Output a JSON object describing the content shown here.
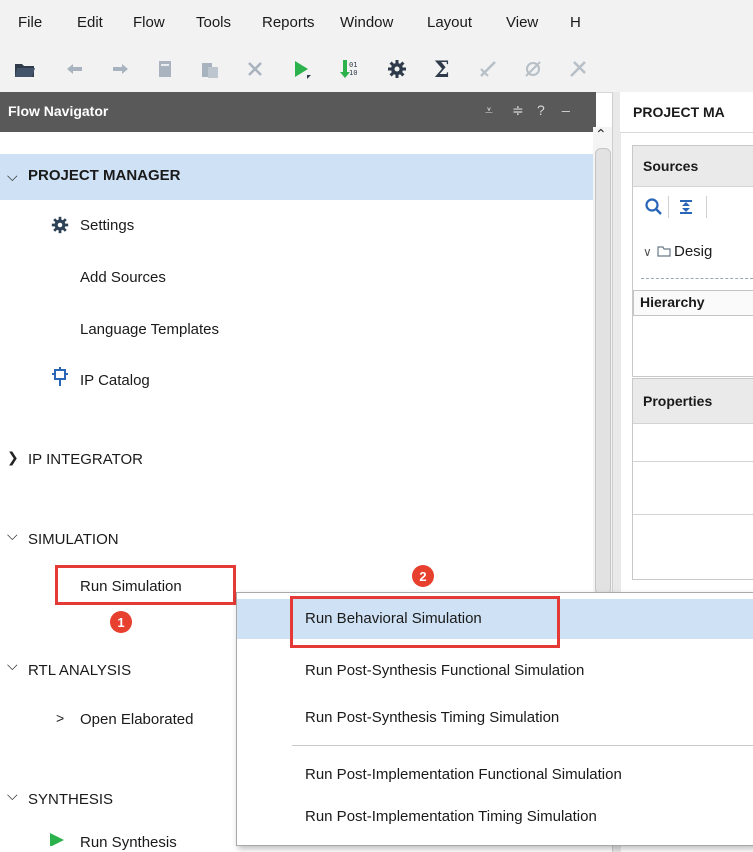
{
  "menubar": {
    "items": [
      {
        "label": "File"
      },
      {
        "label": "Edit"
      },
      {
        "label": "Flow"
      },
      {
        "label": "Tools"
      },
      {
        "label": "Reports"
      },
      {
        "label": "Window"
      },
      {
        "label": "Layout"
      },
      {
        "label": "View"
      },
      {
        "label": "H"
      }
    ]
  },
  "toolbar": {
    "icons": [
      "open-folder-icon",
      "undo-icon",
      "redo-icon",
      "copy-icon",
      "paste-icon",
      "delete-icon",
      "run-icon",
      "program-icon",
      "settings-icon",
      "sum-icon",
      "disabled-tool-icon",
      "disabled-tool-icon-2",
      "disabled-tool-icon-3"
    ]
  },
  "flow_navigator": {
    "title": "Flow Navigator",
    "controls": {
      "collapse": "⩡",
      "expand": "≑",
      "help": "?",
      "minimize": "_"
    },
    "project_manager": {
      "label": "PROJECT MANAGER",
      "items": [
        "Settings",
        "Add Sources",
        "Language Templates",
        "IP Catalog"
      ]
    },
    "ip_integrator": {
      "label": "IP INTEGRATOR"
    },
    "simulation": {
      "label": "SIMULATION",
      "run": "Run Simulation"
    },
    "rtl_analysis": {
      "label": "RTL ANALYSIS",
      "open": "Open Elaborated"
    },
    "synthesis": {
      "label": "SYNTHESIS",
      "run": "Run Synthesis"
    }
  },
  "right_panel": {
    "header": "PROJECT MA",
    "sources": {
      "title": "Sources",
      "tree_item": "Desig",
      "tab": "Hierarchy"
    },
    "properties": {
      "title": "Properties"
    }
  },
  "callouts": {
    "one": "1",
    "two": "2"
  },
  "popup": {
    "items": [
      "Run Behavioral Simulation",
      "Run Post-Synthesis Functional Simulation",
      "Run Post-Synthesis Timing Simulation",
      "Run Post-Implementation Functional Simulation",
      "Run Post-Implementation Timing Simulation"
    ]
  },
  "colors": {
    "accent_red": "#e53935",
    "selected_row": "#cfe2f5",
    "header_dark": "#595959",
    "run_green": "#2bb24c"
  }
}
